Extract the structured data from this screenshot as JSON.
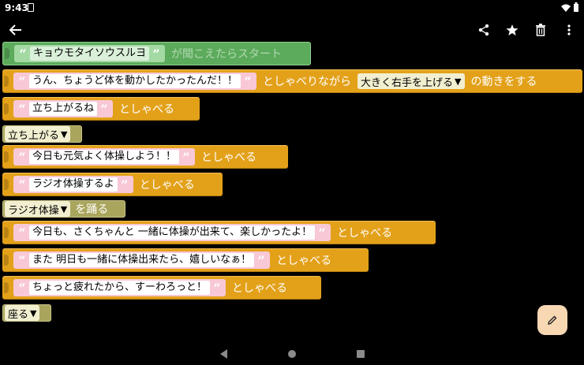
{
  "status": {
    "time": "9:43"
  },
  "program": {
    "hat": {
      "string": "キョウモタイソウスルヨ",
      "label": "が聞こえたらスタート"
    },
    "rows": [
      {
        "string": "うん、ちょうど体を動かしたかったんだ！！",
        "label": "としゃべりながら",
        "dropdown": "大きく右手を上げる",
        "label2": "の動きをする"
      },
      {
        "string": "立ち上がるね",
        "label": "としゃべる"
      },
      {
        "dropdown": "立ち上がる"
      },
      {
        "string": "今日も元気よく体操しよう！！",
        "label": "としゃべる"
      },
      {
        "string": "ラジオ体操するよ",
        "label": "としゃべる"
      },
      {
        "dropdown": "ラジオ体操",
        "label": "を踊る"
      },
      {
        "string": "今日も、さくちゃんと 一緒に体操が出来て、楽しかったよ！",
        "label": "としゃべる"
      },
      {
        "string": "また 明日も一緒に体操出来たら、嬉しいなぁ！",
        "label": "としゃべる"
      },
      {
        "string": "ちょっと疲れたから、すーわろっと！",
        "label": "としゃべる"
      },
      {
        "dropdown": "座る"
      }
    ]
  },
  "colors": {
    "speak_block": "#e3a11a",
    "motion_block": "#a9a55c",
    "hat_block": "#5cab5c",
    "string_field": "#f8c8d6",
    "fab": "#f8d7b3"
  },
  "icons": {
    "back": "arrow-left-icon",
    "share": "share-icon",
    "star": "star-icon",
    "delete": "trash-icon",
    "more": "more-vert-icon",
    "edit": "pencil-icon"
  }
}
